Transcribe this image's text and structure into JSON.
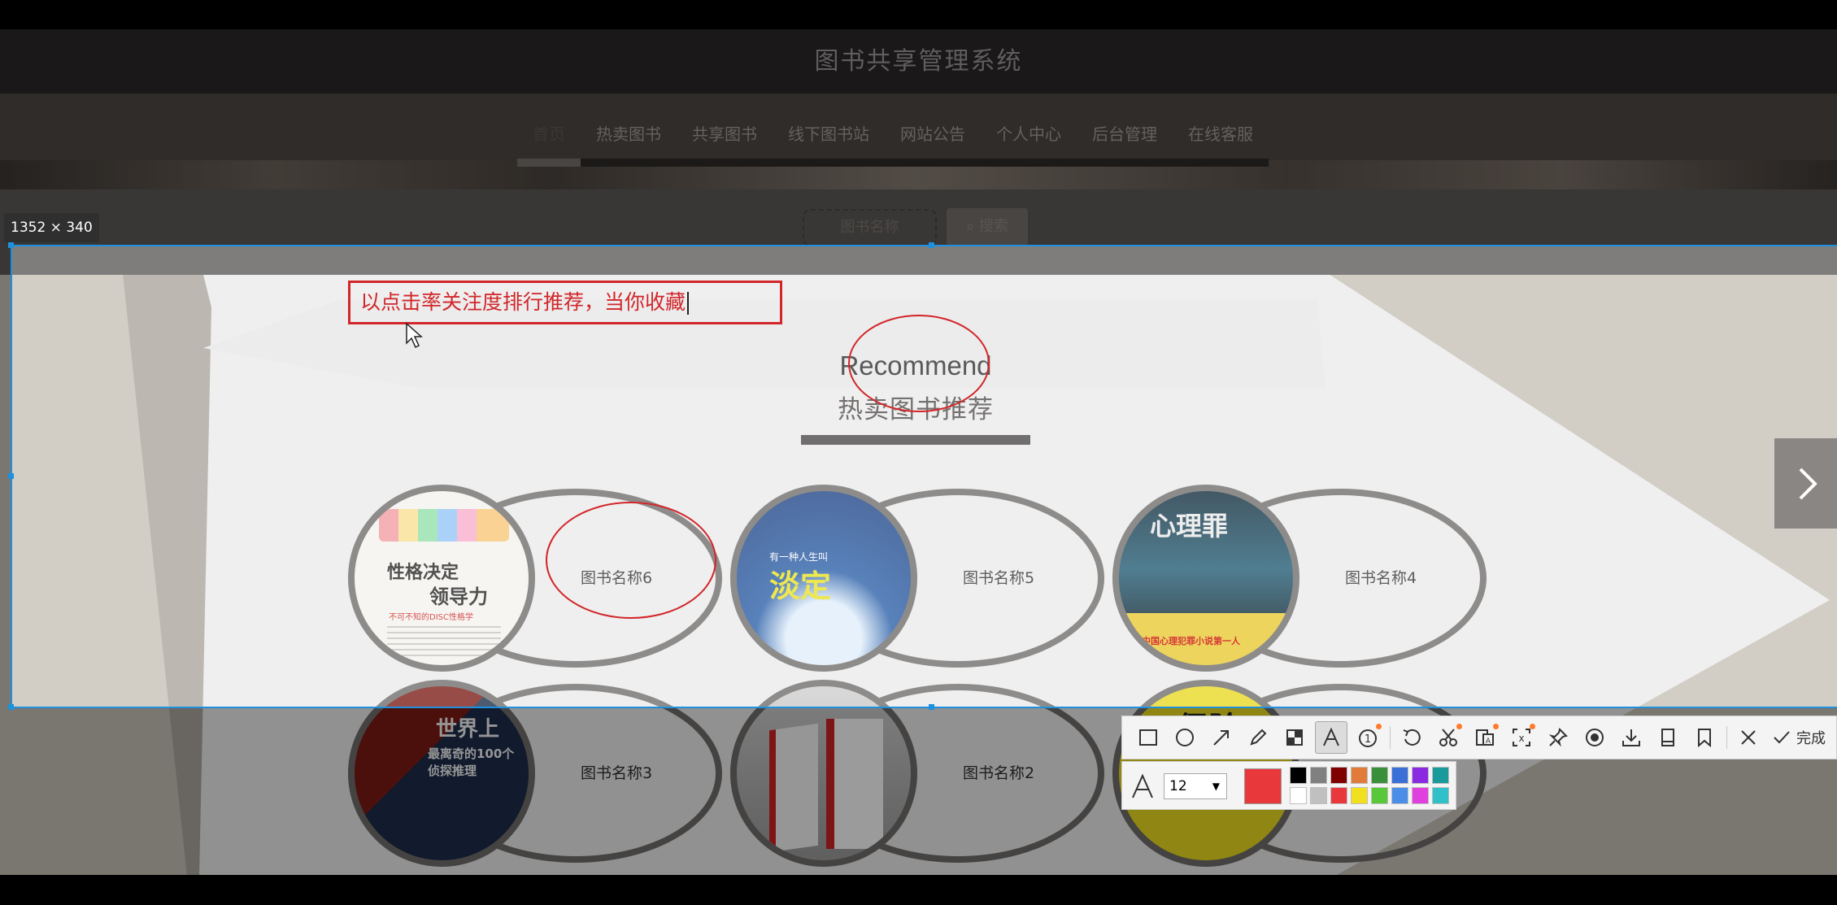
{
  "app": {
    "title": "图书共享管理系统"
  },
  "nav": {
    "items": [
      {
        "label": "首页",
        "active": true
      },
      {
        "label": "热卖图书"
      },
      {
        "label": "共享图书"
      },
      {
        "label": "线下图书站"
      },
      {
        "label": "网站公告"
      },
      {
        "label": "个人中心"
      },
      {
        "label": "后台管理"
      },
      {
        "label": "在线客服"
      }
    ]
  },
  "search": {
    "placeholder": "图书名称",
    "button_label": "搜索",
    "button_icon": "search-icon"
  },
  "recommend": {
    "title": "Recommend",
    "subtitle": "热卖图书推荐",
    "books": [
      {
        "name": "图书名称6",
        "cover_text_1": "性格决定",
        "cover_text_2": "领导力",
        "cover_text_3": "不可不知的DISC性格学"
      },
      {
        "name": "图书名称5",
        "cover_text_1": "有一种人生叫",
        "cover_text_2": "淡定"
      },
      {
        "name": "图书名称4",
        "cover_text_1": "心理罪",
        "cover_text_2": "中国心理犯罪小说第一人"
      },
      {
        "name": "图书名称3",
        "cover_text_1": "世界上",
        "cover_text_2": "最离奇的100个侦探推理"
      },
      {
        "name": "图书名称2",
        "cover_text_1": ""
      },
      {
        "name": "",
        "cover_text_1": "保险"
      }
    ]
  },
  "screenshot_tool": {
    "selection_size": "1352 × 340",
    "annotation_text": "以点击率关注度排行推荐，当你收藏",
    "done_label": "完成",
    "font_size": "12",
    "current_color": "#e8383c",
    "palette": [
      "#000000",
      "#808080",
      "#800000",
      "#e07b39",
      "#3a8f3a",
      "#3a6fd8",
      "#8a2be2",
      "#1a9a9a",
      "#ffffff",
      "#c0c0c0",
      "#e8383c",
      "#f0e020",
      "#58c83a",
      "#4a8ee8",
      "#e040e0",
      "#30c0c8"
    ],
    "tools": [
      "rectangle-icon",
      "ellipse-icon",
      "arrow-icon",
      "pencil-icon",
      "mosaic-icon",
      "text-icon",
      "number-icon",
      "undo-icon",
      "cut-icon",
      "ocr-icon",
      "translate-icon",
      "pin-icon",
      "record-icon",
      "download-icon",
      "long-screenshot-icon",
      "bookmark-icon",
      "close-icon"
    ]
  }
}
